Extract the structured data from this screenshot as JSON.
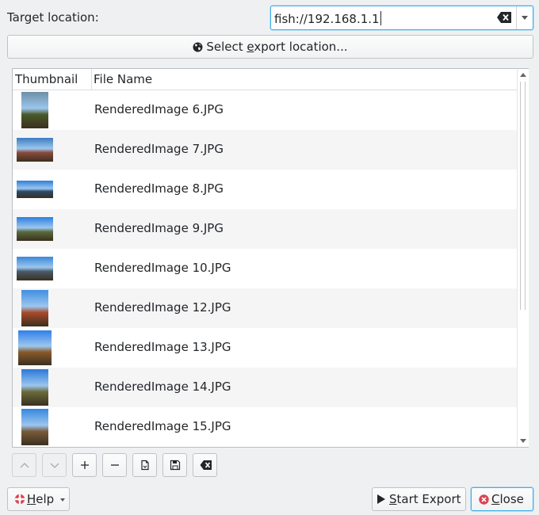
{
  "target": {
    "label": "Target location:",
    "value": "fish://192.168.1.1"
  },
  "select_button": {
    "pre": "Select ",
    "mnemonic": "e",
    "post": "xport location..."
  },
  "list": {
    "columns": [
      "Thumbnail",
      "File Name"
    ],
    "rows": [
      {
        "name": "RenderedImage 6.JPG",
        "thumb": "portrait",
        "sky": "#6d8fa6",
        "ground": "#4a5a2a"
      },
      {
        "name": "RenderedImage 7.JPG",
        "thumb": "landscape",
        "sky": "#3d7cc0",
        "ground": "#8a4a3a"
      },
      {
        "name": "RenderedImage 8.JPG",
        "thumb": "panorama",
        "sky": "#2f7ed8",
        "ground": "#2a4a6a"
      },
      {
        "name": "RenderedImage 9.JPG",
        "thumb": "landscape",
        "sky": "#2a7fe0",
        "ground": "#5a6a3a"
      },
      {
        "name": "RenderedImage 10.JPG",
        "thumb": "landscape",
        "sky": "#3a88d8",
        "ground": "#4a5a6a"
      },
      {
        "name": "RenderedImage 12.JPG",
        "thumb": "portrait",
        "sky": "#3f8fe0",
        "ground": "#a84a2a"
      },
      {
        "name": "RenderedImage 13.JPG",
        "thumb": "square",
        "sky": "#2f80e8",
        "ground": "#8a5a2a"
      },
      {
        "name": "RenderedImage 14.JPG",
        "thumb": "portrait",
        "sky": "#2a78d8",
        "ground": "#6a6a3a"
      },
      {
        "name": "RenderedImage 15.JPG",
        "thumb": "portrait",
        "sky": "#3588e0",
        "ground": "#7a5a3a"
      }
    ]
  },
  "toolbar": [
    {
      "name": "move-up-button",
      "icon": "chevron-up-icon",
      "enabled": false
    },
    {
      "name": "move-down-button",
      "icon": "chevron-down-icon",
      "enabled": false
    },
    {
      "name": "add-button",
      "icon": "plus-icon",
      "enabled": true
    },
    {
      "name": "remove-button",
      "icon": "minus-icon",
      "enabled": true
    },
    {
      "name": "load-button",
      "icon": "document-open-icon",
      "enabled": true
    },
    {
      "name": "save-button",
      "icon": "floppy-icon",
      "enabled": true
    },
    {
      "name": "clear-button",
      "icon": "backspace-icon",
      "enabled": true
    }
  ],
  "buttons": {
    "help": {
      "mnemonic": "H",
      "rest": "elp"
    },
    "start": {
      "mnemonic": "S",
      "rest": "tart Export"
    },
    "close": {
      "mnemonic": "C",
      "rest": "lose"
    }
  },
  "colors": {
    "accent": "#3daee9",
    "close_icon": "#da4453"
  }
}
